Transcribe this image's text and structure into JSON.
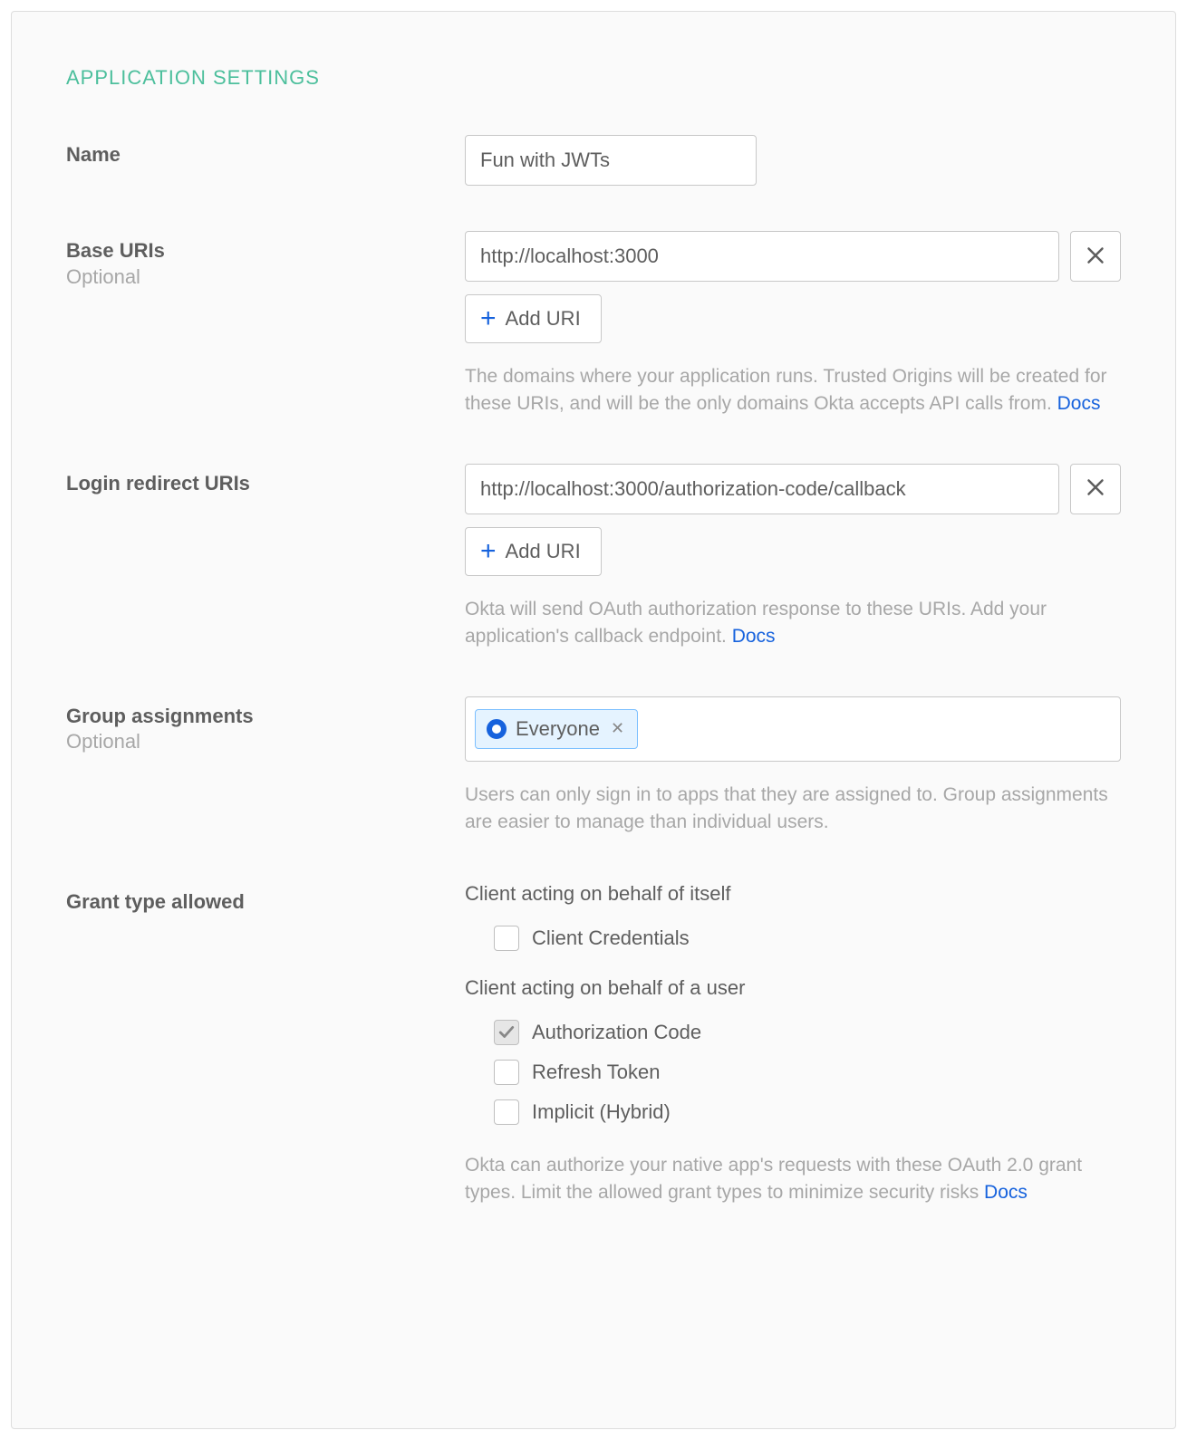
{
  "section": {
    "title": "APPLICATION SETTINGS"
  },
  "name": {
    "label": "Name",
    "value": "Fun with JWTs"
  },
  "baseUris": {
    "label": "Base URIs",
    "optional": "Optional",
    "items": [
      "http://localhost:3000"
    ],
    "addLabel": "Add URI",
    "helper": "The domains where your application runs. Trusted Origins will be created for these URIs, and will be the only domains Okta accepts API calls from. ",
    "docs": "Docs"
  },
  "loginRedirect": {
    "label": "Login redirect URIs",
    "items": [
      "http://localhost:3000/authorization-code/callback"
    ],
    "addLabel": "Add URI",
    "helper": "Okta will send OAuth authorization response to these URIs. Add your application's callback endpoint. ",
    "docs": "Docs"
  },
  "groups": {
    "label": "Group assignments",
    "optional": "Optional",
    "pill": "Everyone",
    "helper": "Users can only sign in to apps that they are assigned to. Group assignments are easier to manage than individual users."
  },
  "grant": {
    "label": "Grant type allowed",
    "selfHeading": "Client acting on behalf of itself",
    "userHeading": "Client acting on behalf of a user",
    "options": {
      "clientCredentials": {
        "label": "Client Credentials",
        "checked": false
      },
      "authorizationCode": {
        "label": "Authorization Code",
        "checked": true
      },
      "refreshToken": {
        "label": "Refresh Token",
        "checked": false
      },
      "implicit": {
        "label": "Implicit (Hybrid)",
        "checked": false
      }
    },
    "helper": "Okta can authorize your native app's requests with these OAuth 2.0 grant types. Limit the allowed grant types to minimize security risks ",
    "docs": "Docs"
  }
}
